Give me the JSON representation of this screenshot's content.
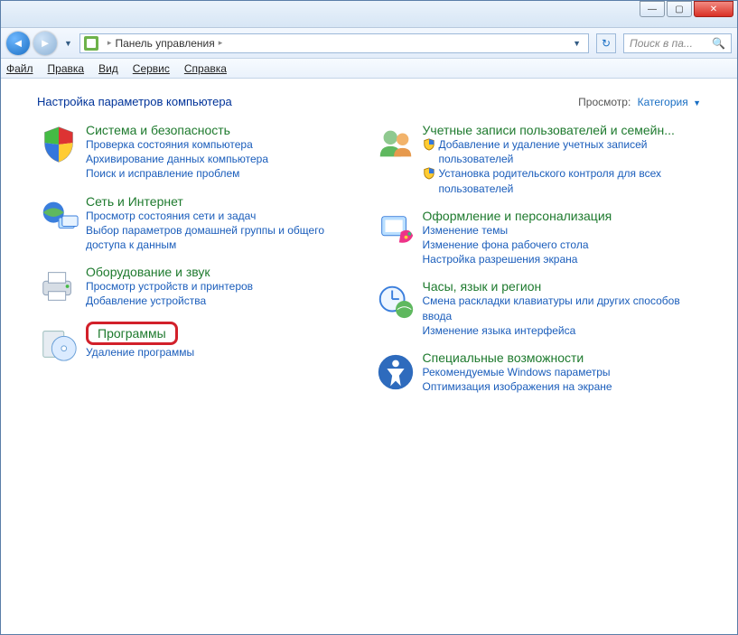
{
  "titlebar": {
    "minimize": "—",
    "maximize": "▢",
    "close": "✕"
  },
  "navbar": {
    "address_root": "Панель управления",
    "search_placeholder": "Поиск в па..."
  },
  "menubar": {
    "file": "Файл",
    "edit": "Правка",
    "view": "Вид",
    "tools": "Сервис",
    "help": "Справка"
  },
  "header": {
    "title": "Настройка параметров компьютера",
    "view_label": "Просмотр:",
    "view_value": "Категория"
  },
  "left": [
    {
      "title": "Система и безопасность",
      "links": [
        "Проверка состояния компьютера",
        "Архивирование данных компьютера",
        "Поиск и исправление проблем"
      ]
    },
    {
      "title": "Сеть и Интернет",
      "links": [
        "Просмотр состояния сети и задач",
        "Выбор параметров домашней группы и общего доступа к данным"
      ]
    },
    {
      "title": "Оборудование и звук",
      "links": [
        "Просмотр устройств и принтеров",
        "Добавление устройства"
      ]
    },
    {
      "title": "Программы",
      "links": [
        "Удаление программы"
      ]
    }
  ],
  "right": [
    {
      "title": "Учетные записи пользователей и семейн...",
      "shield_links": [
        "Добавление и удаление учетных записей пользователей",
        "Установка родительского контроля для всех пользователей"
      ]
    },
    {
      "title": "Оформление и персонализация",
      "links": [
        "Изменение темы",
        "Изменение фона рабочего стола",
        "Настройка разрешения экрана"
      ]
    },
    {
      "title": "Часы, язык и регион",
      "links": [
        "Смена раскладки клавиатуры или других способов ввода",
        "Изменение языка интерфейса"
      ]
    },
    {
      "title": "Специальные возможности",
      "links": [
        "Рекомендуемые Windows параметры",
        "Оптимизация изображения на экране"
      ]
    }
  ]
}
